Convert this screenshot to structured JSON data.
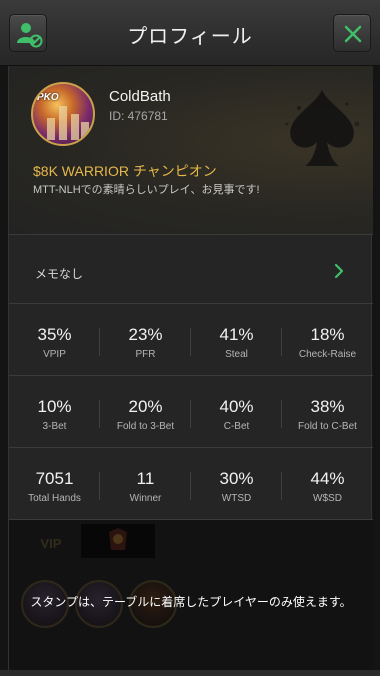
{
  "header": {
    "title": "プロフィール",
    "left_icon": "user-block-icon",
    "right_icon": "close-icon"
  },
  "profile": {
    "username": "ColdBath",
    "user_id": "ID: 476781",
    "avatar_badge": "PKO",
    "achievement_title": "$8K WARRIOR チャンピオン",
    "achievement_desc": "MTT-NLHでの素晴らしいプレイ、お見事です!"
  },
  "memo": {
    "label": "メモなし"
  },
  "stats": {
    "row1": [
      {
        "value": "35%",
        "label": "VPIP"
      },
      {
        "value": "23%",
        "label": "PFR"
      },
      {
        "value": "41%",
        "label": "Steal"
      },
      {
        "value": "18%",
        "label": "Check-Raise"
      }
    ],
    "row2": [
      {
        "value": "10%",
        "label": "3-Bet"
      },
      {
        "value": "20%",
        "label": "Fold to 3-Bet"
      },
      {
        "value": "40%",
        "label": "C-Bet"
      },
      {
        "value": "38%",
        "label": "Fold to C-Bet"
      }
    ],
    "row3": [
      {
        "value": "7051",
        "label": "Total Hands"
      },
      {
        "value": "11",
        "label": "Winner"
      },
      {
        "value": "30%",
        "label": "WTSD"
      },
      {
        "value": "44%",
        "label": "W$SD"
      }
    ]
  },
  "stamps": {
    "vip_tab": "VIP",
    "message": "スタンプは、テーブルに着席したプレイヤーのみ使えます。"
  },
  "colors": {
    "accent_gold": "#e6b84a",
    "close_green": "#3fbf6a",
    "chevron_green": "#3fbf6a"
  }
}
